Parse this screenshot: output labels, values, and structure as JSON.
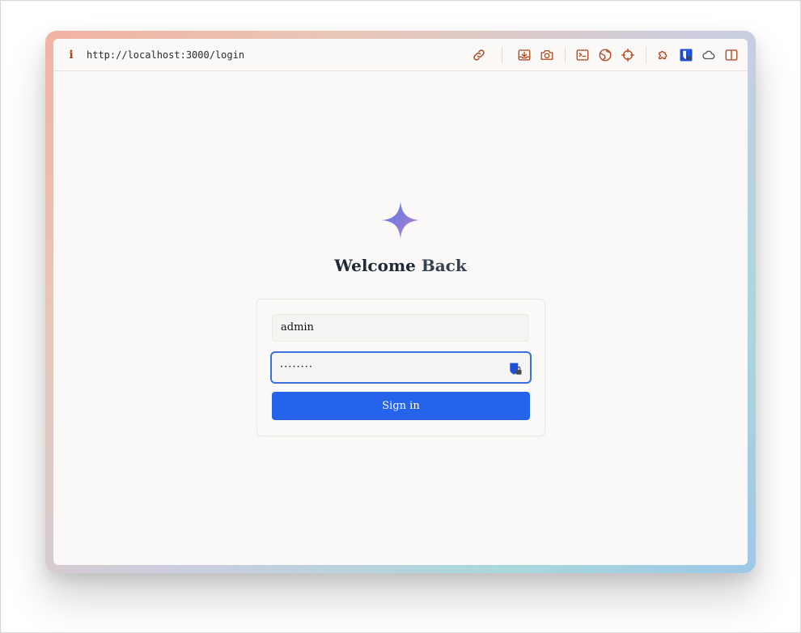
{
  "browser": {
    "url": "http://localhost:3000/login",
    "accent": "#b0451c"
  },
  "login": {
    "heading_first": "Welcome",
    "heading_second": "Back",
    "username_value": "admin",
    "password_mask": "········",
    "submit_label": "Sign in",
    "button_color": "#2563eb"
  },
  "toolbar_icons": [
    "link-icon",
    "download-icon",
    "camera-icon",
    "terminal-icon",
    "globe-icon",
    "crosshair-icon",
    "puzzle-icon",
    "password-manager-icon",
    "cloud-icon",
    "split-view-icon"
  ]
}
